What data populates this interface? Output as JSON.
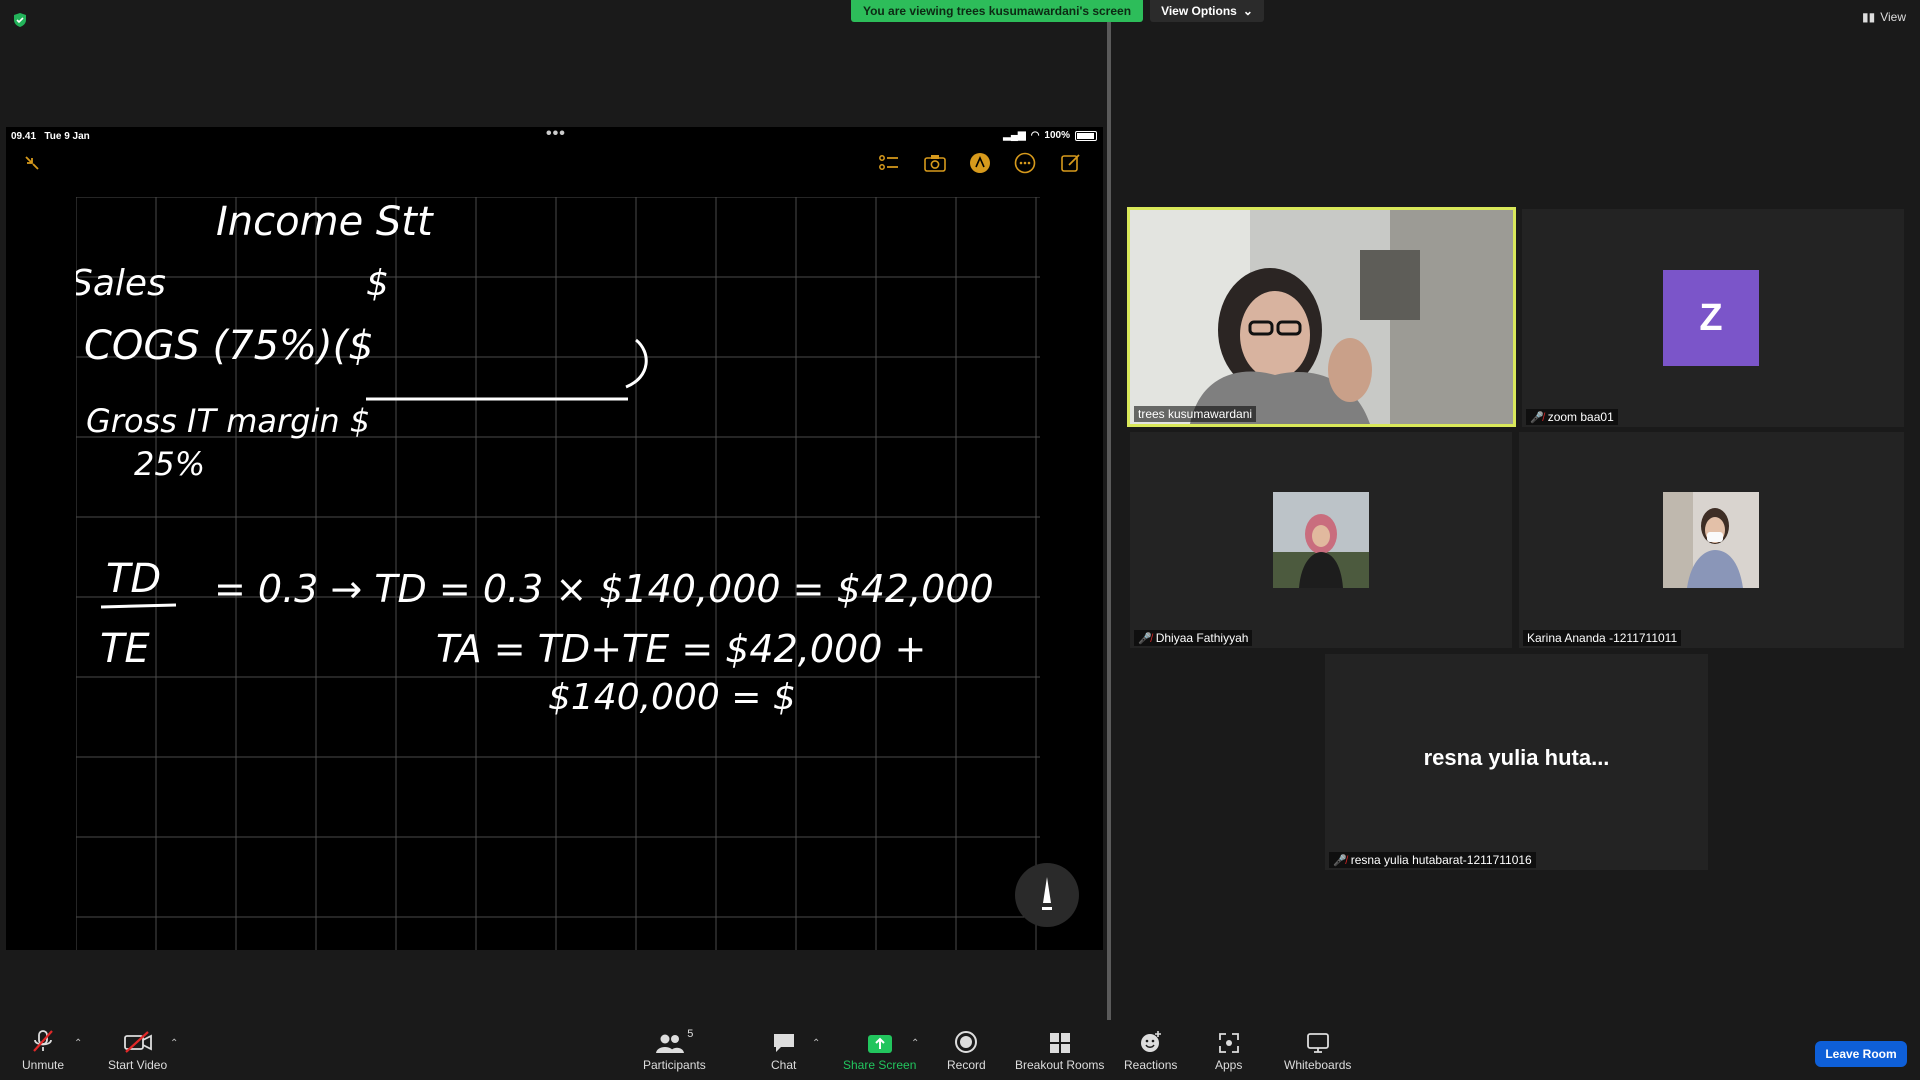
{
  "top": {
    "banner": "You are viewing trees kusumawardani's screen",
    "view_options": "View Options",
    "view": "View"
  },
  "share": {
    "status_time": "09.41",
    "status_date": "Tue 9 Jan",
    "battery": "100%",
    "handwriting": {
      "line1": "Income Stt",
      "line2_left": "Sales",
      "line2_right": "$",
      "line3": "COGS (75%)($",
      "line4": "Gross IT margin $",
      "line5": "25%",
      "frac_top": "TD",
      "frac_bottom": "TE",
      "eq1": "= 0.3 → TD = 0.3 × $140,000 = $42,000",
      "eq2": "TA = TD+TE = $42,000 +",
      "eq3": "$140,000 = $"
    }
  },
  "participants": {
    "trees": "trees kusumawardani",
    "zoom": "zoom baa01",
    "zoom_avatar": "Z",
    "dhiyaa": "Dhiyaa Fathiyyah",
    "karina": "Karina Ananda -1211711011",
    "resna_short": "resna yulia huta...",
    "resna_full": "resna yulia hutabarat-1211711016"
  },
  "toolbar": {
    "unmute": "Unmute",
    "start_video": "Start Video",
    "participants": "Participants",
    "participants_count": "5",
    "chat": "Chat",
    "share_screen": "Share Screen",
    "record": "Record",
    "breakout": "Breakout Rooms",
    "reactions": "Reactions",
    "apps": "Apps",
    "whiteboards": "Whiteboards",
    "leave": "Leave Room"
  },
  "colors": {
    "banner_green": "#2dbd5a",
    "active_speaker": "#d9e85a",
    "avatar_purple": "#7b55c9",
    "leave_blue": "#0e5fd8",
    "share_green": "#22c55e"
  }
}
